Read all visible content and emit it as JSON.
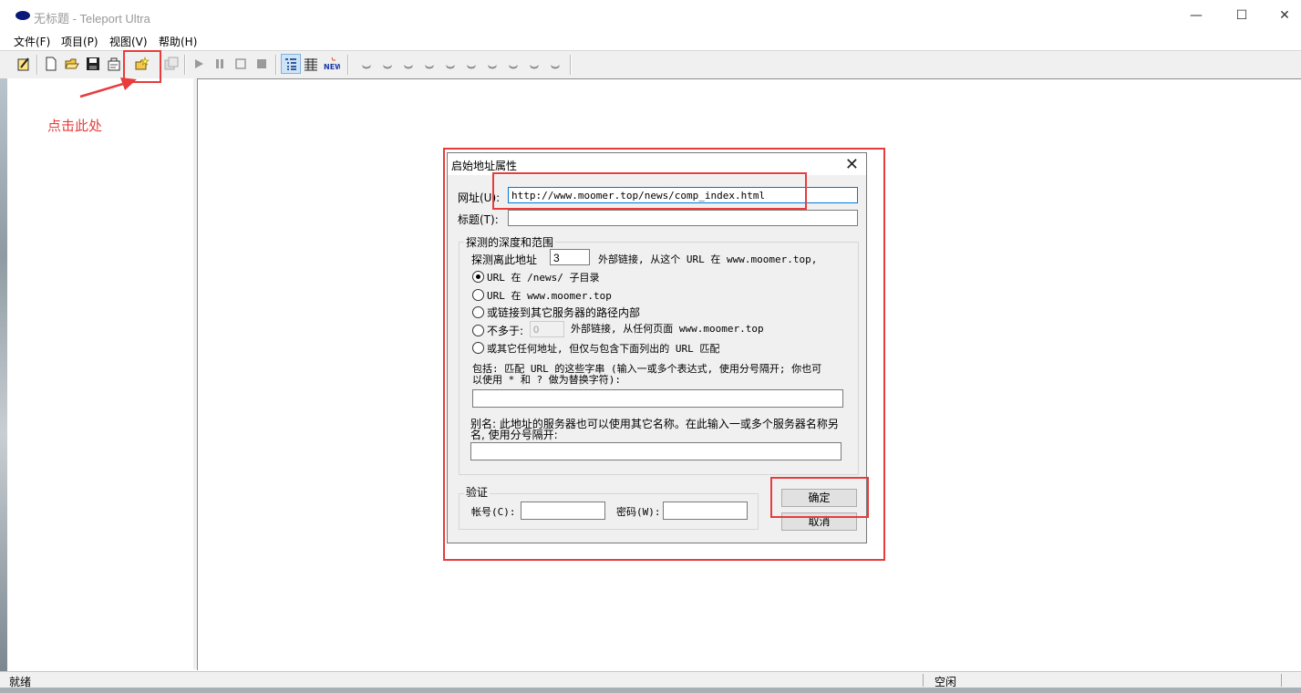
{
  "window": {
    "title": "无标题 - Teleport Ultra"
  },
  "menu": [
    "文件(F)",
    "项目(P)",
    "视图(V)",
    "帮助(H)"
  ],
  "annotation": {
    "text": "点击此处"
  },
  "status": {
    "left": "就绪",
    "right": "空闲"
  },
  "dialog": {
    "title": "启始地址属性",
    "url_label": "网址(U):",
    "url_value": "http://www.moomer.top/news/comp_index.html",
    "title_label": "标题(T):",
    "title_value": "",
    "depth_group": "探测的深度和范围",
    "depth_label": "探测离此地址",
    "depth_value": "3",
    "depth_suffix": "外部链接, 从这个 URL 在 www.moomer.top,",
    "options": [
      {
        "label": "URL 在 /news/ 子目录",
        "checked": true
      },
      {
        "label": "URL 在 www.moomer.top",
        "checked": false
      },
      {
        "label": "或链接到其它服务器的路径内部",
        "checked": false
      },
      {
        "label": "不多于:",
        "checked": false
      },
      {
        "label": "或其它任何地址, 但仅与包含下面列出的 URL 匹配",
        "checked": false
      }
    ],
    "nomore_value": "0",
    "nomore_suffix": "外部链接, 从任何页面 www.moomer.top",
    "include_text_1": "包括: 匹配 URL 的这些字串 (输入一或多个表达式, 使用分号隔开; 你也可",
    "include_text_2": "以使用 * 和 ? 做为替换字符):",
    "alias_text_1": "别名: 此地址的服务器也可以使用其它名称。在此输入一或多个服务器名称另",
    "alias_text_2": "名, 使用分号隔开:",
    "auth_group": "验证",
    "account_label": "帐号(C):",
    "password_label": "密码(W):",
    "ok_label": "确定",
    "cancel_label": "取消"
  }
}
